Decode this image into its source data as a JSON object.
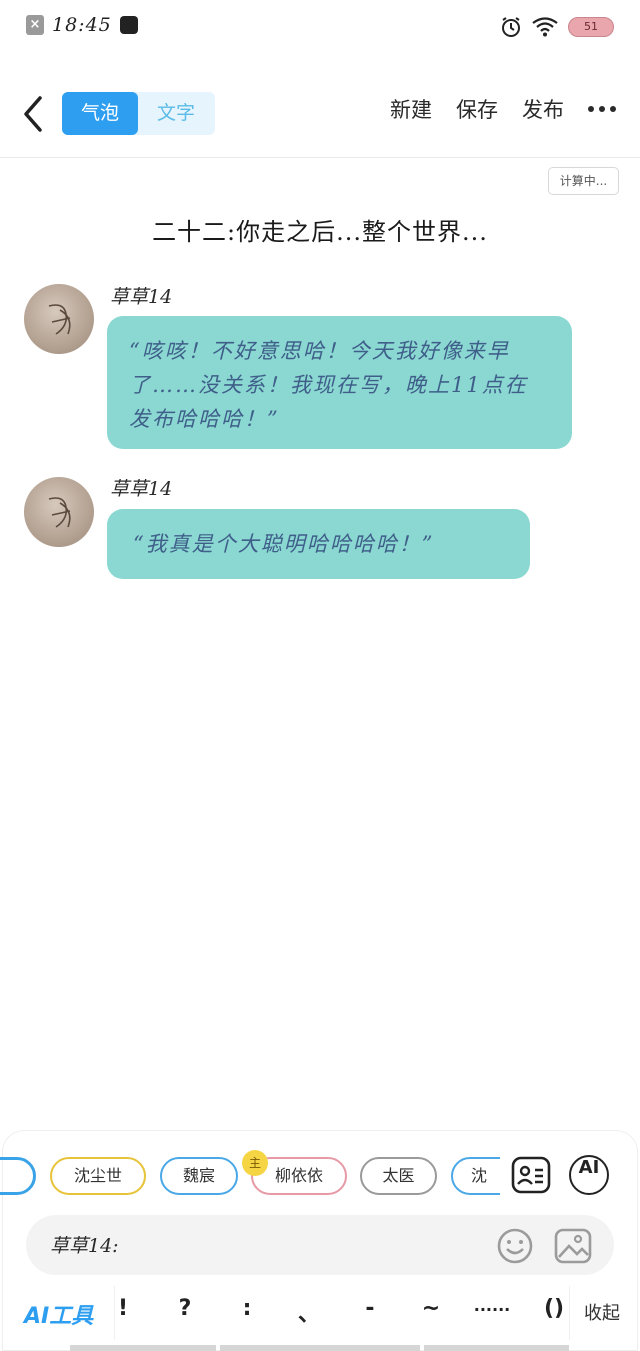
{
  "status_bar": {
    "time": "18:45",
    "battery": "51"
  },
  "header": {
    "tabs": [
      {
        "label": "气泡",
        "active": true
      },
      {
        "label": "文字",
        "active": false
      }
    ],
    "actions": {
      "new": "新建",
      "save": "保存",
      "publish": "发布"
    }
  },
  "calc_badge": "计算中...",
  "story_title": "二十二:你走之后...整个世界...",
  "messages": [
    {
      "sender": "草草14",
      "text": "“咳咳！不好意思哈！今天我好像来早了……没关系！我现在写，晚上11点在发布哈哈哈！”"
    },
    {
      "sender": "草草14",
      "text": "“我真是个大聪明哈哈哈哈！”"
    }
  ],
  "characters": [
    "沈尘世",
    "魏宸",
    "柳依依",
    "太医",
    "沈"
  ],
  "host_badge": "主",
  "ai_tool_label": "AI",
  "input": {
    "value": "草草14:"
  },
  "toolbar": {
    "ai_tools": "AI工具",
    "punctuation": [
      "!",
      "?",
      ":",
      "、",
      "-",
      "~",
      "......",
      "()"
    ],
    "collapse": "收起"
  },
  "colors": {
    "accent": "#2e9ef0",
    "bubble": "#8ad8d1",
    "bubble_text": "#3f5f8a"
  }
}
